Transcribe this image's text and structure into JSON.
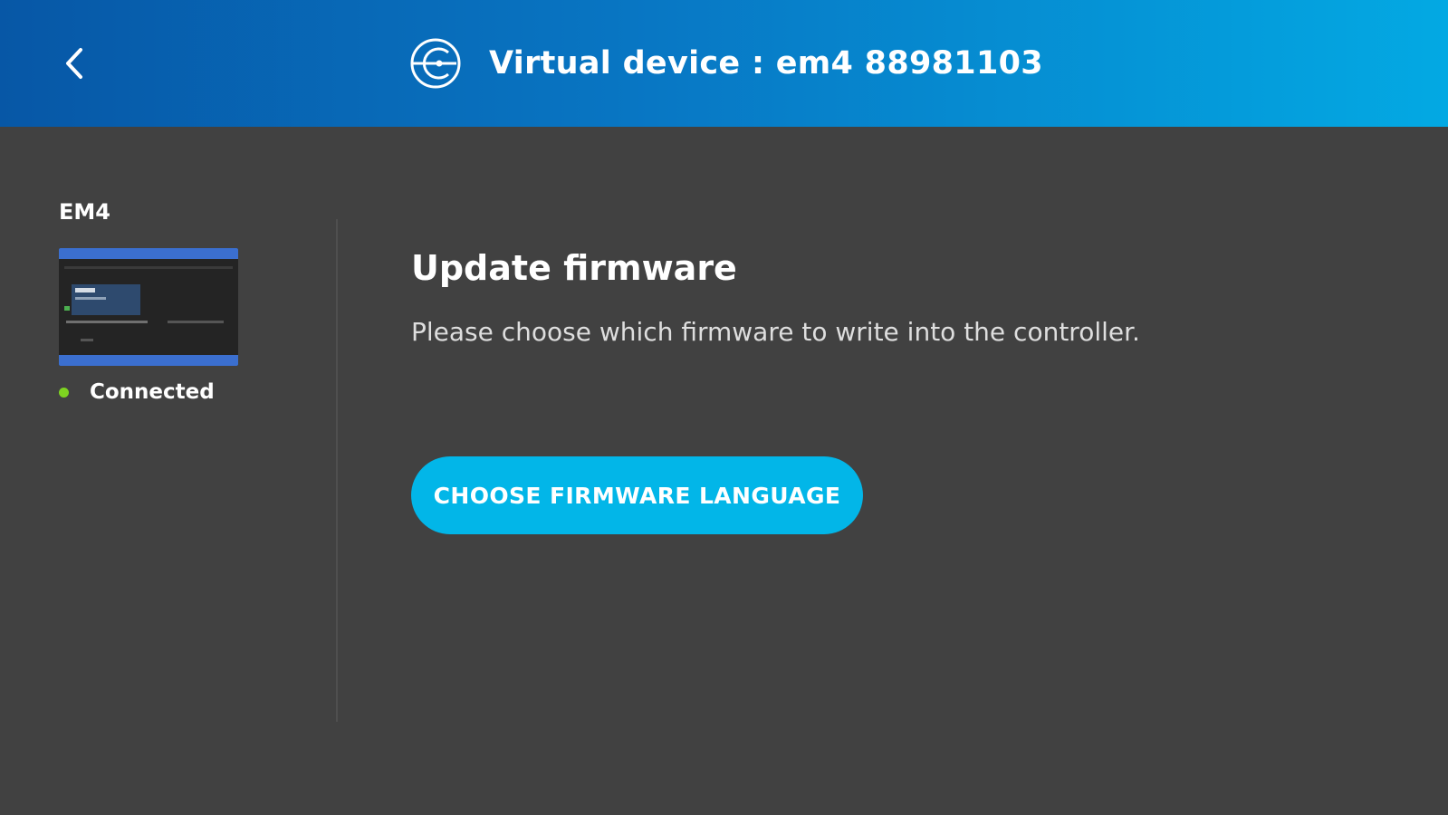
{
  "header": {
    "title": "Virtual device : em4 88981103",
    "back_icon": "chevron-left-icon",
    "logo_icon": "app-logo-icon",
    "gradient_colors": [
      "#0757a6",
      "#03a9e3"
    ]
  },
  "sidebar": {
    "device_name": "EM4",
    "status_label": "Connected",
    "status_color": "#7ed321"
  },
  "main": {
    "title": "Update firmware",
    "description": "Please choose which firmware to write into the controller.",
    "button_label": "CHOOSE FIRMWARE LANGUAGE",
    "button_color": "#02b6e8"
  }
}
